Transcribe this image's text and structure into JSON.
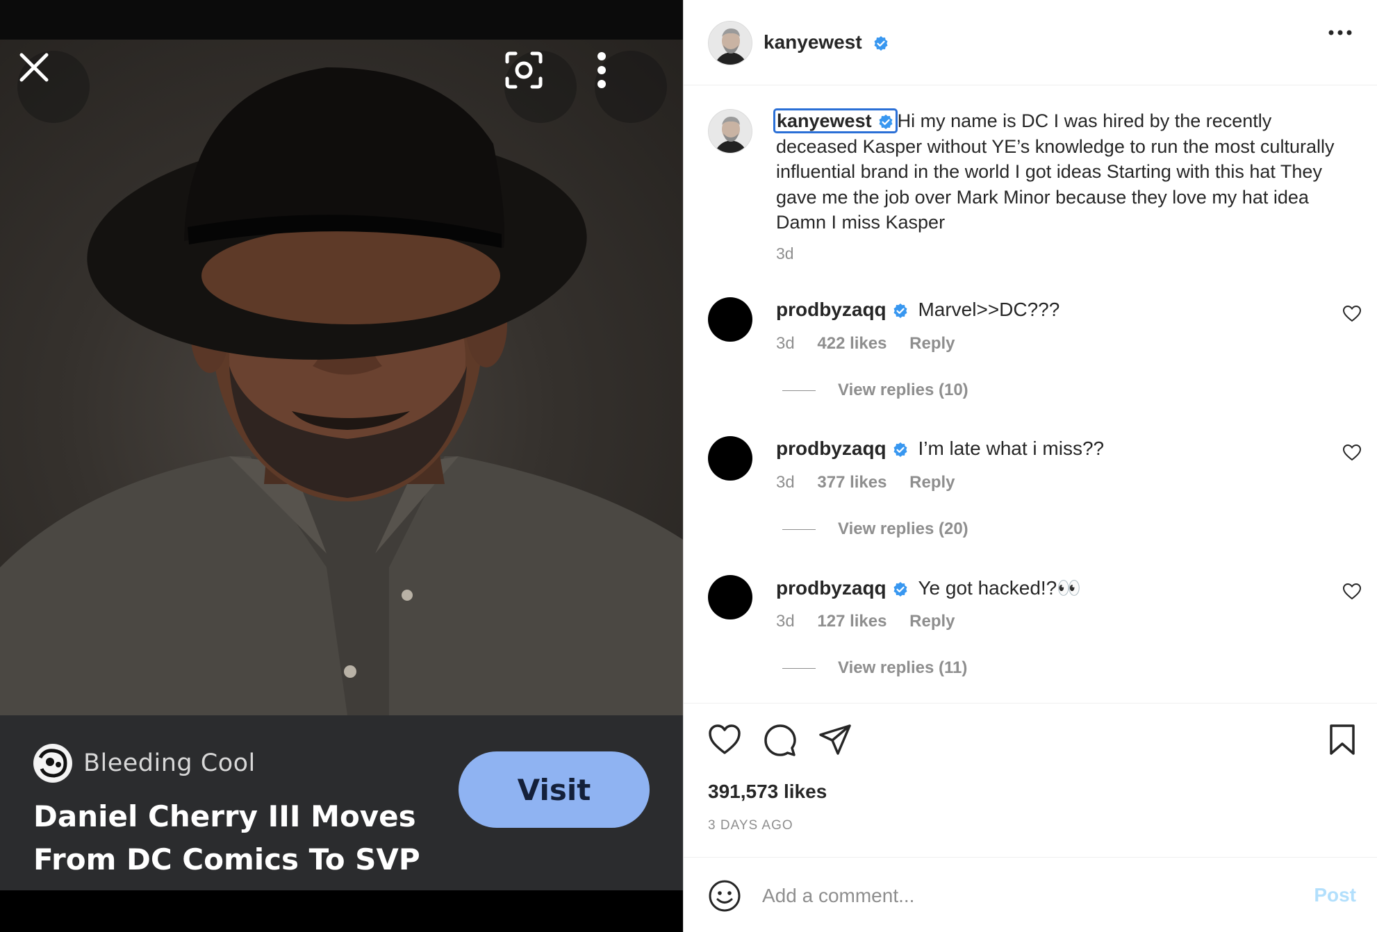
{
  "media": {
    "source_name": "Bleeding Cool",
    "headline": "Daniel Cherry III Moves From DC Comics To SVP ...",
    "visit_label": "Visit"
  },
  "post": {
    "author": "kanyewest",
    "caption_user": "kanyewest",
    "caption_text": "Hi my name is DC I was hired by the recently deceased Kasper without YE’s knowledge to run the most culturally influential brand in the world I got ideas Starting with this hat They gave me the job over Mark Minor because they love my hat idea Damn I miss Kasper",
    "caption_time": "3d",
    "likes": "391,573 likes",
    "date": "3 DAYS AGO"
  },
  "comments": [
    {
      "user": "prodbyzaqq",
      "text": "Marvel>>DC???",
      "time": "3d",
      "likes": "422 likes",
      "reply": "Reply",
      "view_replies": "View replies (10)"
    },
    {
      "user": "prodbyzaqq",
      "text": "I’m late what i miss??",
      "time": "3d",
      "likes": "377 likes",
      "reply": "Reply",
      "view_replies": "View replies (20)"
    },
    {
      "user": "prodbyzaqq",
      "text": "Ye got hacked!?👀",
      "time": "3d",
      "likes": "127 likes",
      "reply": "Reply",
      "view_replies": "View replies (11)"
    }
  ],
  "add_comment": {
    "placeholder": "Add a comment...",
    "post_label": "Post"
  },
  "colors": {
    "verified": "#3897f0",
    "visit_button": "#8fb3f2",
    "post_disabled": "#b2dffc",
    "selection_outline": "#2a6fd6"
  },
  "icons": [
    "close-icon",
    "lens-icon",
    "more-vertical-icon",
    "verified-badge-icon",
    "more-horizontal-icon",
    "heart-icon",
    "comment-icon",
    "share-icon",
    "bookmark-icon",
    "emoji-icon"
  ]
}
